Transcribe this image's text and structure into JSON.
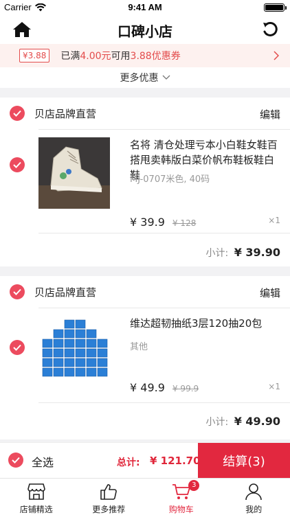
{
  "status_bar": {
    "carrier": "Carrier",
    "time": "9:41 AM",
    "battery_level": 1.0
  },
  "nav": {
    "title": "口碑小店"
  },
  "promo": {
    "tag": "¥3.88",
    "text_1": "已满",
    "amount": "4.00元",
    "text_2": "可用",
    "coupon": "3.88优惠券"
  },
  "more_promo": {
    "label": "更多优惠"
  },
  "shops": [
    {
      "name": "贝店品牌直营",
      "edit": "编辑",
      "item": {
        "title": "名将 清仓处理亏本小白鞋女鞋百搭甩卖韩版白菜价帆布鞋板鞋白鞋",
        "spec": "MJ-0707米色, 40码",
        "price": "¥ 39.9",
        "orig_price": "¥ 128",
        "qty": "×1"
      },
      "subtotal_label": "小计:",
      "subtotal": "¥ 39.90"
    },
    {
      "name": "贝店品牌直营",
      "edit": "编辑",
      "item": {
        "title": "维达超韧抽纸3层120抽20包",
        "spec": "其他",
        "price": "¥ 49.9",
        "orig_price": "¥ 99.9",
        "qty": "×1"
      },
      "subtotal_label": "小计:",
      "subtotal": "¥ 49.90"
    }
  ],
  "checkout": {
    "select_all": "全选",
    "total_label": "总计:",
    "total": "¥ 121.70",
    "pay_label": "结算(3)"
  },
  "tabs": [
    {
      "label": "店铺精选",
      "icon": "shop-icon"
    },
    {
      "label": "更多推荐",
      "icon": "thumbs-up-icon"
    },
    {
      "label": "购物车",
      "icon": "cart-icon",
      "badge": "3"
    },
    {
      "label": "我的",
      "icon": "user-icon"
    }
  ],
  "colors": {
    "accent": "#e2283f",
    "check": "#ec4b5e",
    "promo_bg": "#fdf1ef"
  }
}
